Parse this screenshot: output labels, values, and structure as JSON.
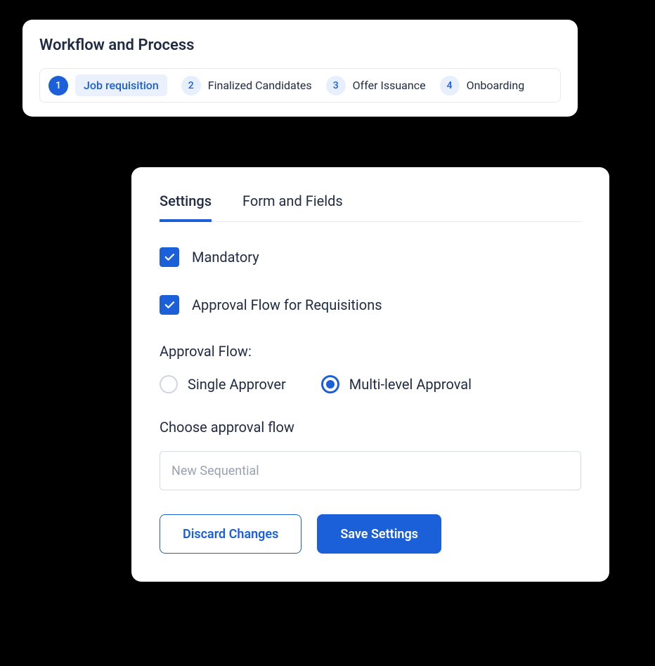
{
  "workflow": {
    "title": "Workflow and Process",
    "steps": [
      {
        "num": "1",
        "label": "Job requisition",
        "active": true
      },
      {
        "num": "2",
        "label": "Finalized Candidates",
        "active": false
      },
      {
        "num": "3",
        "label": "Offer Issuance",
        "active": false
      },
      {
        "num": "4",
        "label": "Onboarding",
        "active": false
      }
    ]
  },
  "settings": {
    "tabs": [
      {
        "label": "Settings",
        "active": true
      },
      {
        "label": "Form and Fields",
        "active": false
      }
    ],
    "checkboxes": {
      "mandatory": {
        "label": "Mandatory",
        "checked": true
      },
      "approval_flow_req": {
        "label": "Approval Flow for Requisitions",
        "checked": true
      }
    },
    "approval_flow_label": "Approval Flow:",
    "radios": {
      "single": {
        "label": "Single Approver",
        "selected": false
      },
      "multi": {
        "label": "Multi-level Approval",
        "selected": true
      }
    },
    "choose_label": "Choose approval flow",
    "choose_placeholder": "New Sequential",
    "buttons": {
      "discard": "Discard Changes",
      "save": "Save Settings"
    }
  }
}
